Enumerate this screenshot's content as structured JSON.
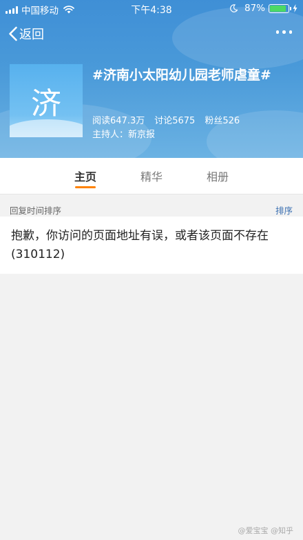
{
  "status_bar": {
    "carrier": "中国移动",
    "time": "下午4:38",
    "battery_percent": "87%",
    "battery_level": 0.87,
    "icons": [
      "signal-icon",
      "wifi-icon",
      "moon-icon",
      "battery-icon",
      "charging-bolt-icon"
    ]
  },
  "nav": {
    "back_label": "返回",
    "back_icon": "chevron-left-icon",
    "more_icon": "more-dots-icon"
  },
  "topic": {
    "logo_char": "济",
    "title": "#济南小太阳幼儿园老师虐童#",
    "stats": {
      "reads": "阅读647.3万",
      "discussions": "讨论5675",
      "fans": "粉丝526"
    },
    "host": "主持人：新京报"
  },
  "tabs": [
    {
      "label": "主页",
      "active": true
    },
    {
      "label": "精华",
      "active": false
    },
    {
      "label": "相册",
      "active": false
    }
  ],
  "sort": {
    "label": "回复时间排序",
    "button": "排序"
  },
  "message": {
    "text": "抱歉，你访问的页面地址有误，或者该页面不存在 (310112)"
  },
  "watermark": "@爱宝宝 @知乎",
  "colors": {
    "header_blue": "#4a9ad9",
    "tab_accent": "#ff8200",
    "link_blue": "#3a6fb1",
    "battery_green": "#4cd964"
  }
}
